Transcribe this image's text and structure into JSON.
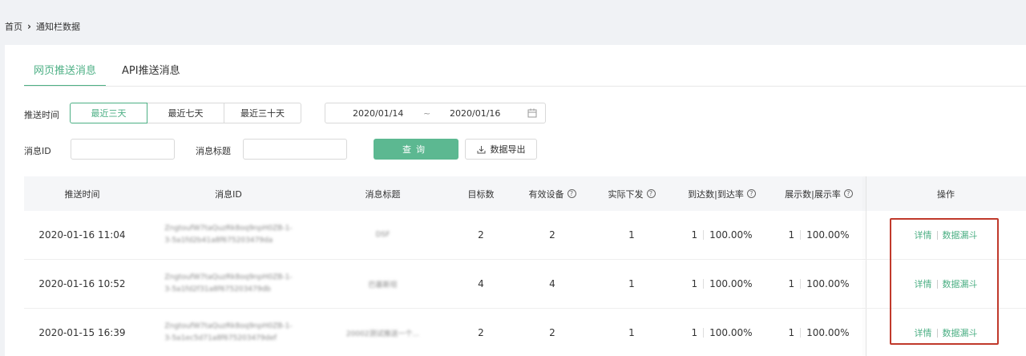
{
  "breadcrumb": {
    "home": "首页",
    "current": "通知栏数据"
  },
  "tabs": [
    {
      "label": "网页推送消息",
      "active": true
    },
    {
      "label": "API推送消息",
      "active": false
    }
  ],
  "filters": {
    "push_time_label": "推送时间",
    "ranges": [
      "最近三天",
      "最近七天",
      "最近三十天"
    ],
    "date_start": "2020/01/14",
    "date_sep": "~",
    "date_end": "2020/01/16",
    "msg_id_label": "消息ID",
    "msg_id_value": "",
    "msg_title_label": "消息标题",
    "msg_title_value": "",
    "query_label": "查询",
    "export_label": "数据导出"
  },
  "table": {
    "headers": {
      "time": "推送时间",
      "id": "消息ID",
      "title": "消息标题",
      "target": "目标数",
      "valid": "有效设备",
      "actual": "实际下发",
      "arrive": "到达数|到达率",
      "show": "展示数|展示率",
      "ops": "操作"
    },
    "rows": [
      {
        "time": "2020-01-16 11:04",
        "id_line1": "ZngtoufW7taQuzRk8oq9npH0ZB-1-",
        "id_line2": "3-5a1fd2b41a8f675203479da",
        "title": "DSF",
        "target": "2",
        "valid": "2",
        "actual": "1",
        "arrive_n": "1",
        "arrive_r": "100.00%",
        "show_n": "1",
        "show_r": "100.00%",
        "op_detail": "详情",
        "op_funnel": "数据漏斗"
      },
      {
        "time": "2020-01-16 10:52",
        "id_line1": "ZngtoufW7taQuzRk8oq9npH0ZB-1-",
        "id_line2": "3-5a1fd2f31a8f675203479db",
        "title": "巴基斯坦",
        "target": "4",
        "valid": "4",
        "actual": "1",
        "arrive_n": "1",
        "arrive_r": "100.00%",
        "show_n": "1",
        "show_r": "100.00%",
        "op_detail": "详情",
        "op_funnel": "数据漏斗"
      },
      {
        "time": "2020-01-15 16:39",
        "id_line1": "ZngtoufW7taQuzRk8oq9npH0ZB-1-",
        "id_line2": "3-5a1ec5d71a8f675203479def",
        "title": "20002测试推送一个...",
        "target": "2",
        "valid": "2",
        "actual": "1",
        "arrive_n": "1",
        "arrive_r": "100.00%",
        "show_n": "1",
        "show_r": "100.00%",
        "op_detail": "详情",
        "op_funnel": "数据漏斗"
      }
    ]
  },
  "colors": {
    "accent": "#4caf84",
    "highlight_box": "#c0392b"
  }
}
